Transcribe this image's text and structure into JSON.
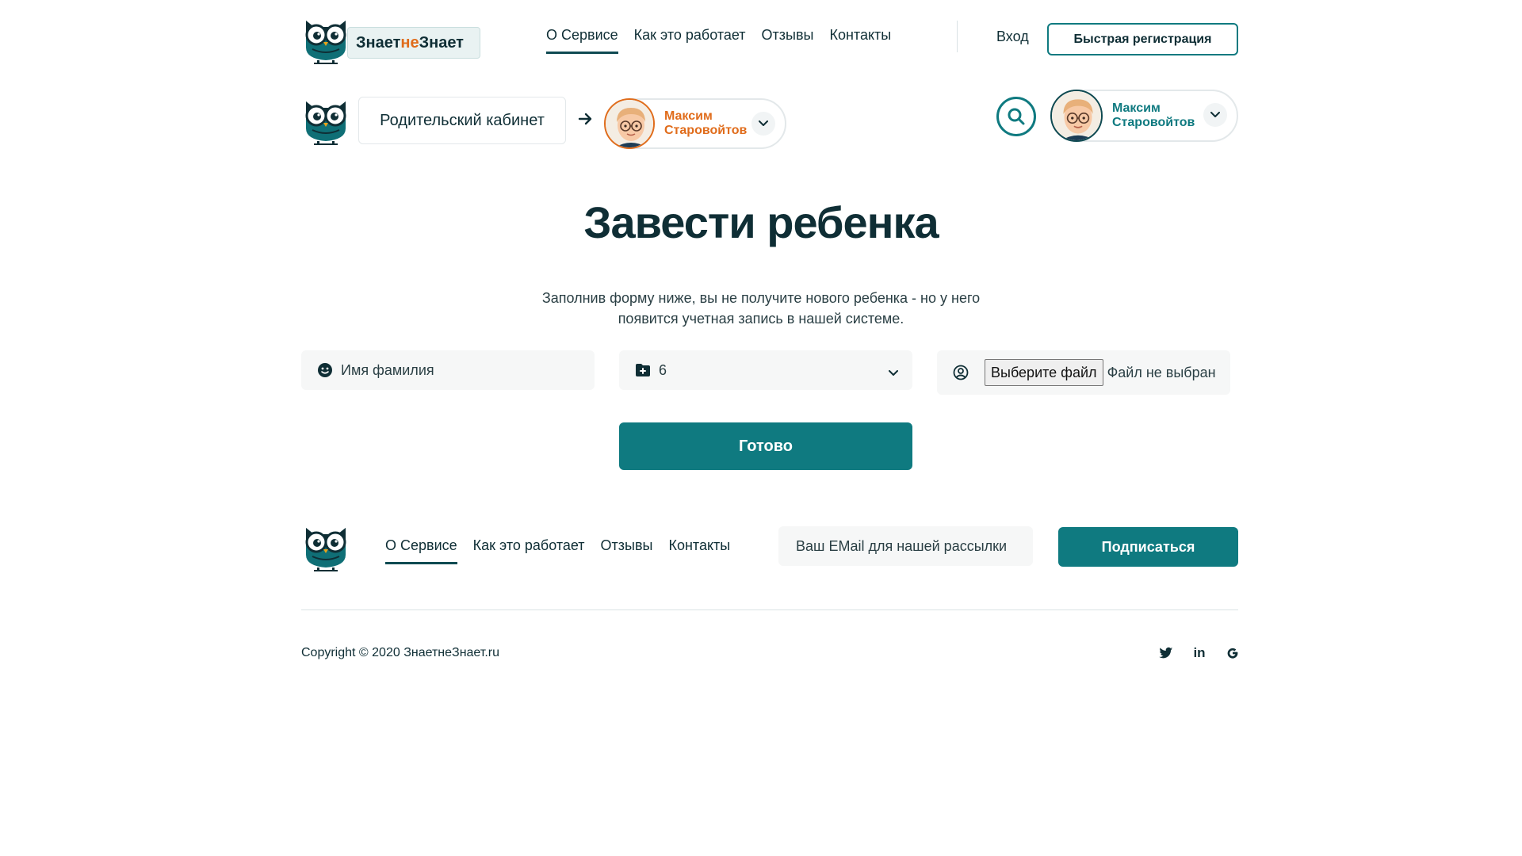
{
  "header": {
    "logo": {
      "text_main": "Знает",
      "text_accent": "не",
      "text_end": "Знает",
      "icon": "owl-logo-icon"
    },
    "nav": [
      {
        "label": "О Сервисе",
        "active": true
      },
      {
        "label": "Как это работает",
        "active": false
      },
      {
        "label": "Отзывы",
        "active": false
      },
      {
        "label": "Контакты",
        "active": false
      }
    ],
    "login_label": "Вход",
    "register_label": "Быстрая регистрация"
  },
  "cabinet_bar": {
    "title": "Родительский кабинет",
    "arrow_icon": "arrow-right-icon",
    "child": {
      "first": "Максим",
      "last": "Старовойтов"
    },
    "user": {
      "first": "Максим",
      "last": "Старовойтов"
    }
  },
  "main": {
    "title": "Завести ребенка",
    "subtitle": "Заполнив форму ниже, вы не получите нового ребенка - но у него появится учетная запись в нашей системе.",
    "name_placeholder": "Имя фамилия",
    "age_value": "6",
    "file_button": "Выберите файл",
    "file_status": "Файл не выбран",
    "submit_label": "Готово"
  },
  "footer": {
    "nav": [
      {
        "label": "О Сервисе",
        "active": true
      },
      {
        "label": "Как это работает",
        "active": false
      },
      {
        "label": "Отзывы",
        "active": false
      },
      {
        "label": "Контакты",
        "active": false
      }
    ],
    "email_placeholder": "Ваш EMail для нашей рассылки",
    "subscribe_label": "Подписаться",
    "copyright": "Copyright © 2020 ЗнаетнеЗнает.ru",
    "socials": [
      "twitter-icon",
      "linkedin-icon",
      "google-icon"
    ]
  },
  "colors": {
    "brand": "#0f7a80",
    "dark": "#0f2e35",
    "accent": "#e06c1b"
  }
}
